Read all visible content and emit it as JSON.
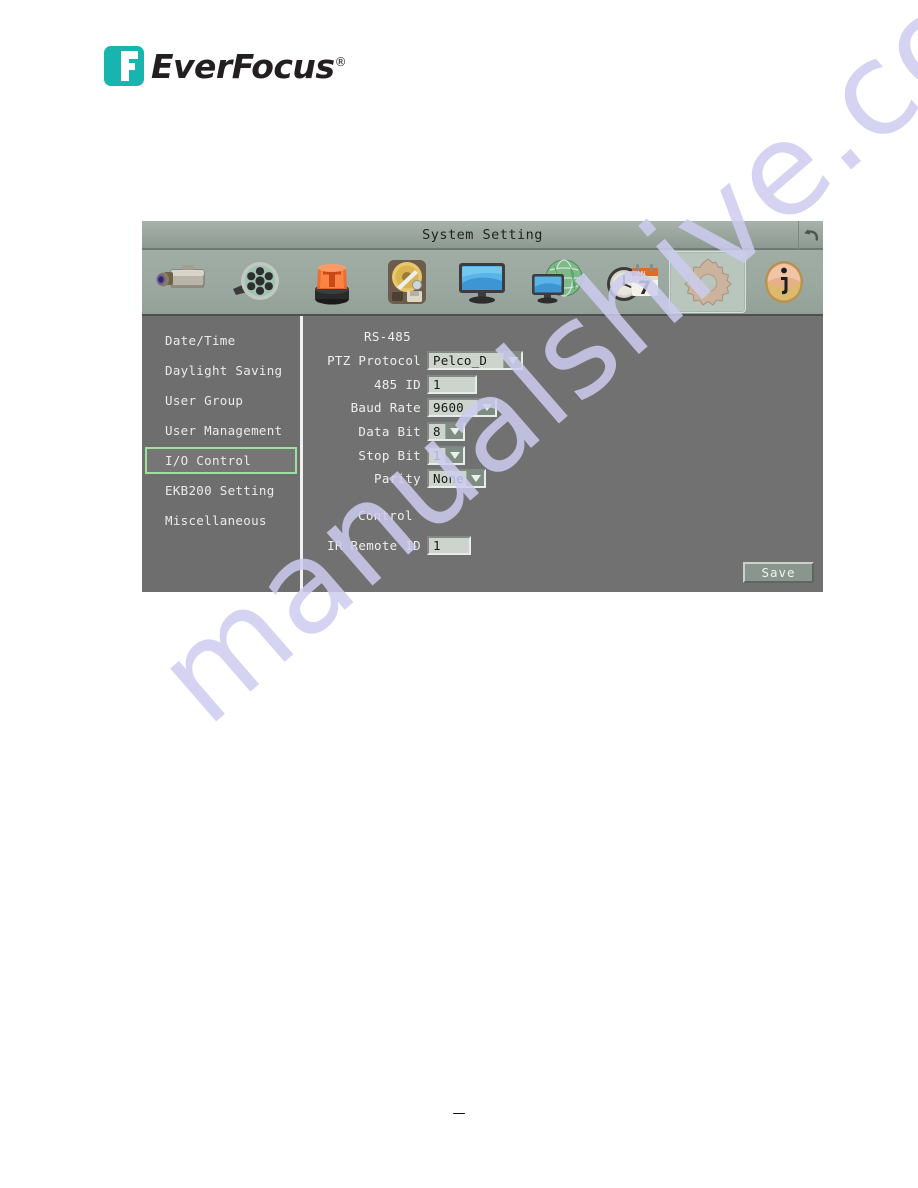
{
  "page": {
    "brand": {
      "name": "EverFocus",
      "registered_mark": "®",
      "logo_color": "#18b5b0",
      "wordmark_color": "#231f20"
    },
    "watermark": "manualshive.com",
    "footer_mark": "—"
  },
  "dvr": {
    "titlebar": {
      "title": "System Setting",
      "back_icon": "back-arrow-icon"
    },
    "toolbar": {
      "selected_index": 7,
      "items": [
        {
          "icon": "camera-icon",
          "label": "Camera"
        },
        {
          "icon": "film-reel-icon",
          "label": "Record"
        },
        {
          "icon": "alarm-beacon-icon",
          "label": "Alarm"
        },
        {
          "icon": "hard-disk-icon",
          "label": "Disk"
        },
        {
          "icon": "monitor-icon",
          "label": "Display"
        },
        {
          "icon": "network-globe-icon",
          "label": "Network"
        },
        {
          "icon": "clock-calendar-icon",
          "label": "Schedule"
        },
        {
          "icon": "gear-icon",
          "label": "System"
        },
        {
          "icon": "info-icon",
          "label": "Information"
        }
      ],
      "calendar_month": "JAN",
      "calendar_day": "7"
    },
    "sidebar": {
      "selected_index": 4,
      "selected_color": "#9fe09f",
      "items": [
        {
          "label": "Date/Time"
        },
        {
          "label": "Daylight Saving"
        },
        {
          "label": "User Group"
        },
        {
          "label": "User Management"
        },
        {
          "label": "I/O Control"
        },
        {
          "label": "EKB200 Setting"
        },
        {
          "label": "Miscellaneous"
        }
      ]
    },
    "form": {
      "rs485": {
        "heading": "RS-485",
        "fields": [
          {
            "label": "PTZ Protocol",
            "value": "Pelco_D",
            "type": "dropdown"
          },
          {
            "label": "485 ID",
            "value": "1",
            "type": "text"
          },
          {
            "label": "Baud Rate",
            "value": "9600",
            "type": "dropdown"
          },
          {
            "label": "Data Bit",
            "value": "8",
            "type": "dropdown"
          },
          {
            "label": "Stop Bit",
            "value": "1",
            "type": "dropdown"
          },
          {
            "label": "Parity",
            "value": "None",
            "type": "dropdown"
          }
        ]
      },
      "control": {
        "heading": "Control",
        "fields": [
          {
            "label": "IR Remote ID",
            "value": "1",
            "type": "text"
          }
        ]
      },
      "save_label": "Save"
    }
  }
}
